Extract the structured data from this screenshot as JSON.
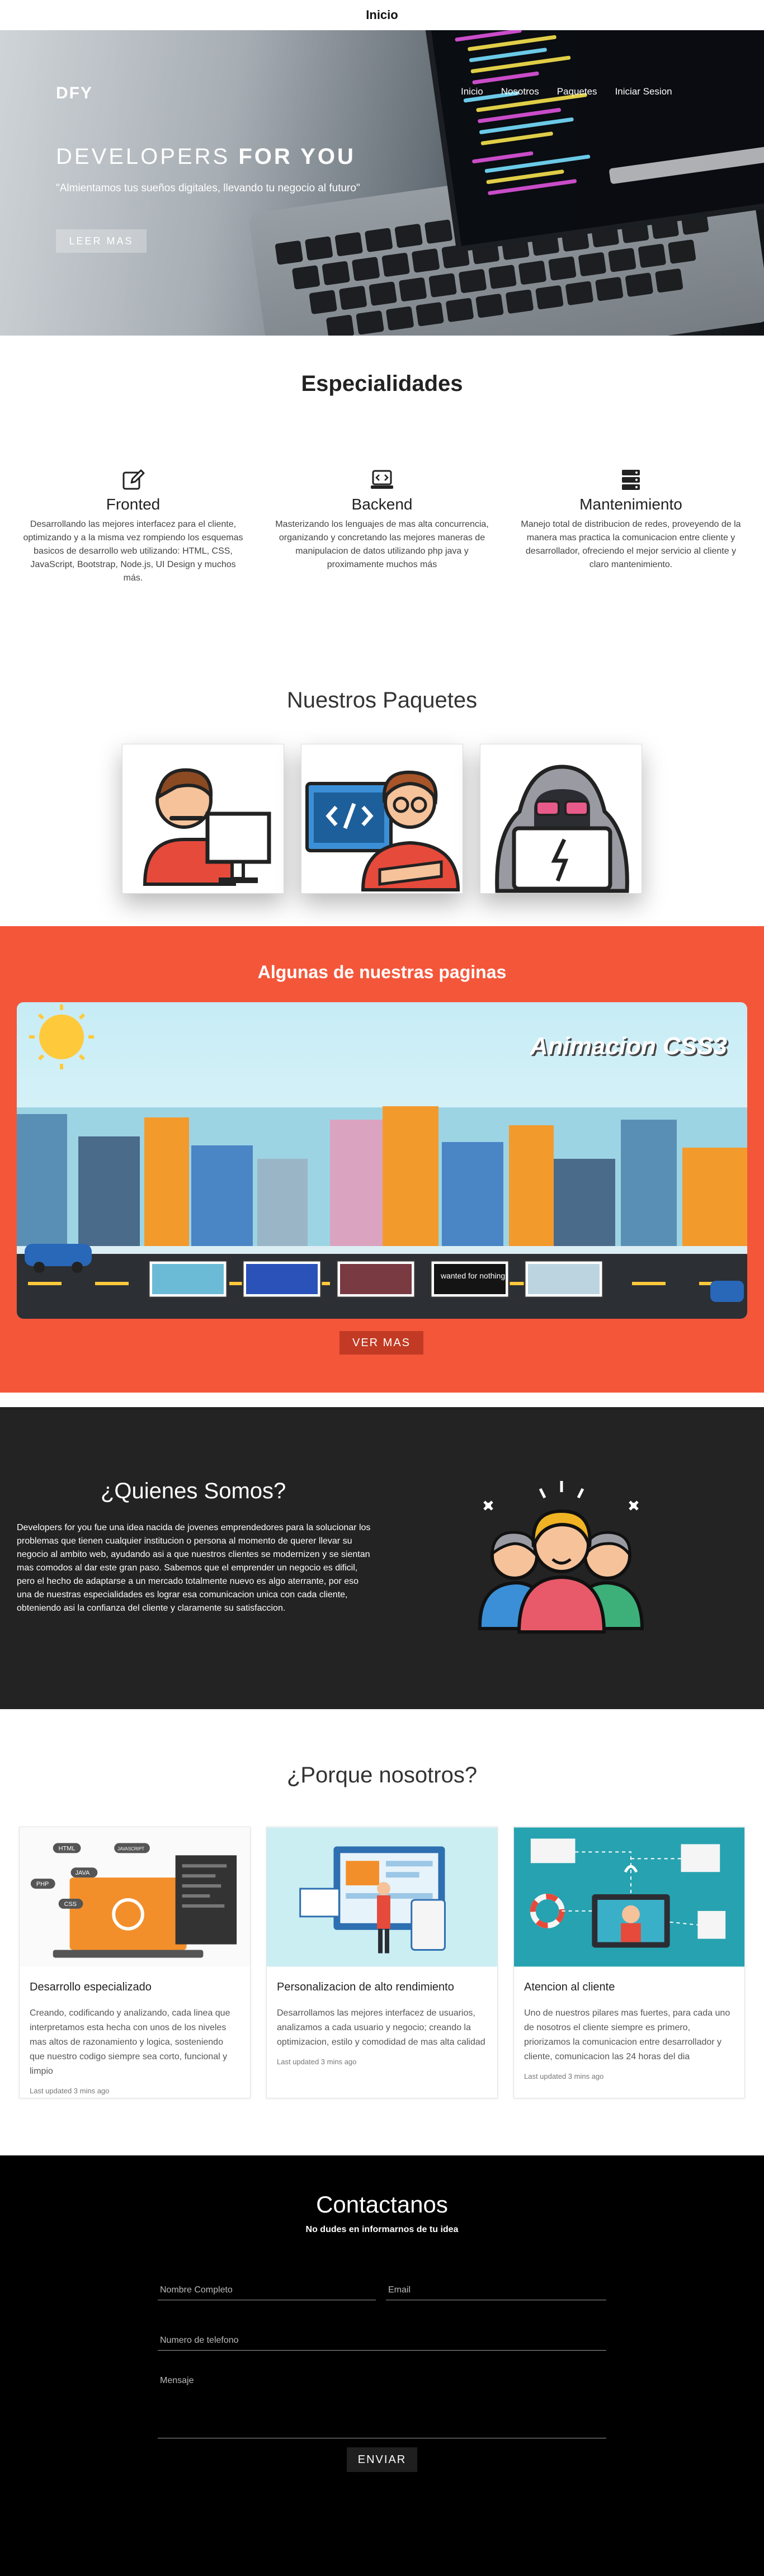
{
  "topbar": {
    "title": "Inicio"
  },
  "hero": {
    "logo": "DFY",
    "nav": [
      "Inicio",
      "Nosotros",
      "Paquetes",
      "Iniciar Sesion"
    ],
    "title_light": "DEVELOPERS ",
    "title_bold": "FOR YOU",
    "subtitle": "\"Almientamos tus sueños digitales, llevando tu negocio al futuro\"",
    "button": "LEER MAS"
  },
  "especialidades": {
    "title": "Especialidades",
    "items": [
      {
        "icon": "edit-icon",
        "name": "Fronted",
        "desc": "Desarrollando las mejores interfacez para el cliente, optimizando y a la misma vez rompiendo los esquemas basicos de desarrollo web utilizando: HTML, CSS, JavaScript, Bootstrap, Node.js, UI Design y muchos más."
      },
      {
        "icon": "code-laptop-icon",
        "name": "Backend",
        "desc": "Masterizando los lenguajes de mas alta concurrencia, organizando y concretando las mejores maneras de manipulacion de datos utilizando php java y proximamente muchos más"
      },
      {
        "icon": "server-icon",
        "name": "Mantenimiento",
        "desc": "Manejo total de distribucion de redes, proveyendo de la manera mas practica la comunicacion entre cliente y desarrollador, ofreciendo el mejor servicio al cliente y claro mantenimiento."
      }
    ]
  },
  "paquetes": {
    "title": "Nuestros Paquetes"
  },
  "paginas": {
    "title": "Algunas de nuestras paginas",
    "animacion": "Animacion CSS3",
    "button": "VER MAS",
    "thumb_text": "wanted for nothing"
  },
  "quienes": {
    "title": "¿Quienes Somos?",
    "text": "Developers for you fue una idea nacida de jovenes emprendedores para la solucionar los problemas que tienen cualquier institucion o persona al momento de querer llevar su negocio al ambito web, ayudando asi a que nuestros clientes se modernizen y se sientan mas comodos al dar este gran paso. Sabemos que el emprender un negocio es dificil, pero el hecho de adaptarse a un mercado totalmente nuevo es algo aterrante, por eso una de nuestras especialidades es lograr esa comunicacion unica con cada cliente, obteniendo asi la confianza del cliente y claramente su satisfaccion."
  },
  "porque": {
    "title": "¿Porque nosotros?",
    "cards": [
      {
        "name": "Desarrollo especializado",
        "desc": "Creando, codificando y analizando, cada linea que interpretamos esta hecha con unos de los niveles mas altos de razonamiento y logica, sosteniendo que nuestro codigo siempre sea corto, funcional y limpio",
        "updated": "Last updated 3 mins ago",
        "tags": [
          "HTML",
          "JAVASCRIPT",
          "PHP",
          "JAVA",
          "CSS"
        ]
      },
      {
        "name": "Personalizacion de alto rendimiento",
        "desc": "Desarrollamos las mejores interfacez de usuarios, analizamos a cada usuario y negocio; creando la optimizacion, estilo y comodidad de mas alta calidad",
        "updated": "Last updated 3 mins ago"
      },
      {
        "name": "Atencion al cliente",
        "desc": "Uno de nuestros pilares mas fuertes, para cada uno de nosotros el cliente siempre es primero, priorizamos la comunicacion entre desarrollador y cliente, comunicacion las 24 horas del dia",
        "updated": "Last updated 3 mins ago"
      }
    ]
  },
  "contacto": {
    "title": "Contactanos",
    "subtitle": "No dudes en informarnos de tu idea",
    "nombre_placeholder": "Nombre Completo",
    "email_placeholder": "Email",
    "telefono_placeholder": "Numero de telefono",
    "mensaje_placeholder": "Mensaje",
    "button": "ENVIAR"
  },
  "colors": {
    "accent_orange": "#f4563a",
    "dark_section": "#232323",
    "footer": "#000000"
  }
}
